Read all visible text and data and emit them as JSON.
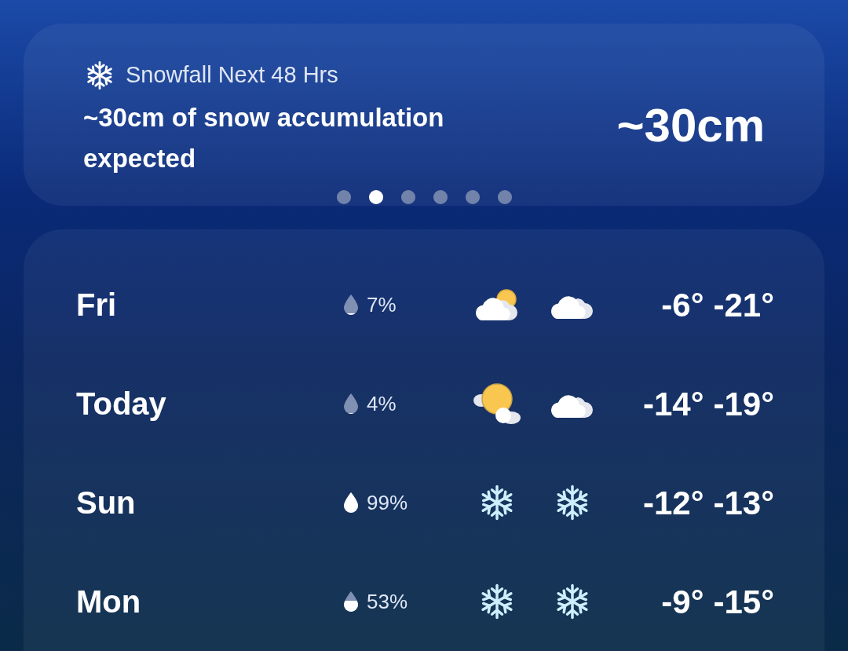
{
  "alert": {
    "title": "Snowfall Next 48 Hrs",
    "message": "~30cm of snow accumulation expected",
    "amount": "~30cm",
    "pages": [
      {
        "selected": false
      },
      {
        "selected": true
      },
      {
        "selected": false
      },
      {
        "selected": false
      },
      {
        "selected": false
      },
      {
        "selected": false
      }
    ]
  },
  "forecast": [
    {
      "day": "Fri",
      "precip": "7%",
      "level": 0.07,
      "icons": [
        {
          "kind": "partly-cloudy"
        },
        {
          "kind": "cloudy"
        }
      ],
      "high": "-6°",
      "low": "-21°"
    },
    {
      "day": "Today",
      "precip": "4%",
      "level": 0.04,
      "icons": [
        {
          "kind": "sunny-cloud"
        },
        {
          "kind": "cloudy"
        }
      ],
      "high": "-14°",
      "low": "-19°"
    },
    {
      "day": "Sun",
      "precip": "99%",
      "level": 0.99,
      "icons": [
        {
          "kind": "snow"
        },
        {
          "kind": "snow"
        }
      ],
      "high": "-12°",
      "low": "-13°"
    },
    {
      "day": "Mon",
      "precip": "53%",
      "level": 0.53,
      "icons": [
        {
          "kind": "snow"
        },
        {
          "kind": "snow"
        }
      ],
      "high": "-9°",
      "low": "-15°"
    }
  ]
}
